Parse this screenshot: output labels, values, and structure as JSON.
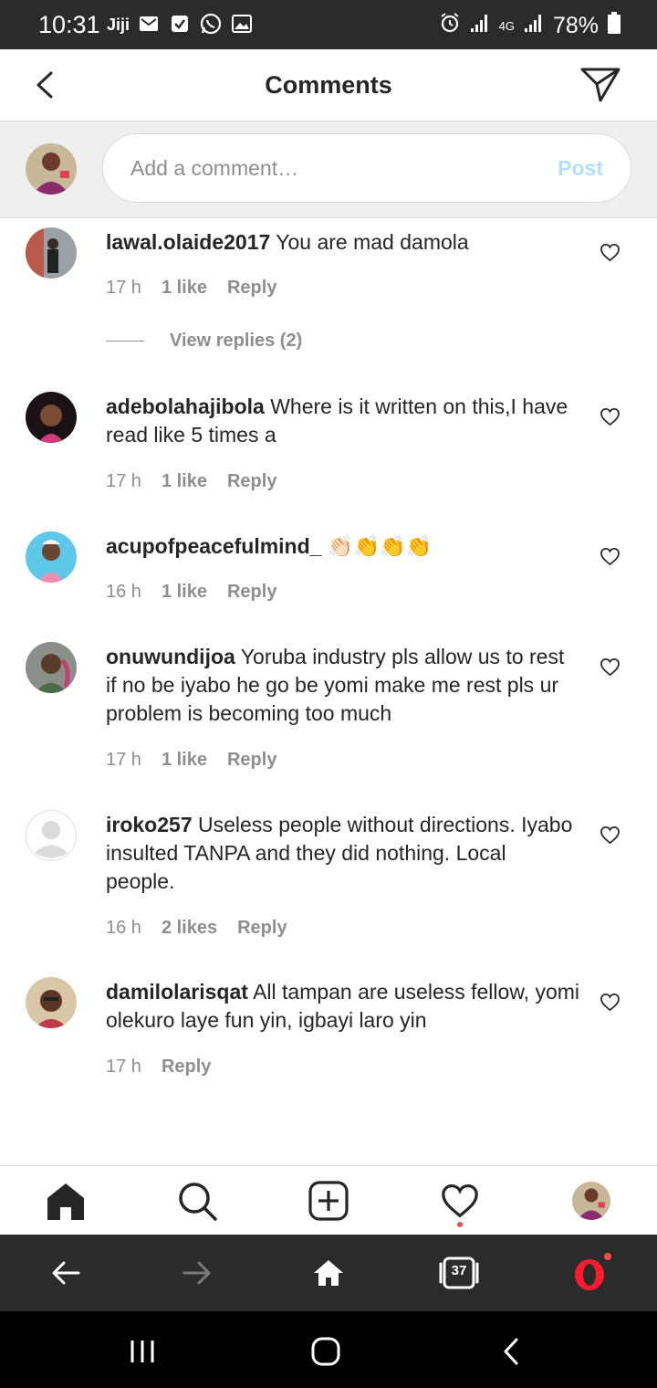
{
  "status_bar": {
    "time": "10:31",
    "battery": "78%",
    "network": "4G",
    "left_icons": [
      "jiji-icon",
      "gmail-icon",
      "checkbox-icon",
      "whatsapp-icon",
      "gallery-icon"
    ],
    "right_icons": [
      "alarm-icon",
      "signal-icon",
      "signal-icon",
      "battery-icon"
    ]
  },
  "header": {
    "title": "Comments",
    "back_icon": "chevron-left-icon",
    "share_icon": "direct-message-icon"
  },
  "add_comment": {
    "placeholder": "Add a comment…",
    "post_label": "Post"
  },
  "comments": [
    {
      "username": "lawal.olaide2017",
      "text": "You are mad damola",
      "time": "17 h",
      "likes": "1 like",
      "reply": "Reply",
      "view_replies": "View replies (2)"
    },
    {
      "username": "adebolahajibola",
      "text": "Where is it written on this,I have read like 5 times a",
      "time": "17 h",
      "likes": "1 like",
      "reply": "Reply"
    },
    {
      "username": "acupofpeacefulmind_",
      "text": "👏🏻👏👏👏",
      "time": "16 h",
      "likes": "1 like",
      "reply": "Reply"
    },
    {
      "username": "onuwundijoa",
      "text": "Yoruba industry pls allow us to rest if no be iyabo he go be yomi make me rest pls ur problem is becoming too much",
      "time": "17 h",
      "likes": "1 like",
      "reply": "Reply"
    },
    {
      "username": "iroko257",
      "text": "Useless people without directions. Iyabo insulted TANPA and they did nothing. Local people.",
      "time": "16 h",
      "likes": "2 likes",
      "reply": "Reply"
    },
    {
      "username": "damilolarisqat",
      "text": "All tampan are useless fellow, yomi olekuro laye fun yin, igbayi laro yin",
      "time": "17 h",
      "reply": "Reply"
    }
  ],
  "bottom_nav": [
    "home-icon",
    "search-icon",
    "new-post-icon",
    "activity-heart-icon",
    "profile-avatar"
  ],
  "browser_bar": {
    "tabs_count": "37",
    "items": [
      "back-arrow-icon",
      "forward-arrow-icon",
      "home-icon",
      "tabs-icon",
      "opera-menu-icon"
    ]
  },
  "system_nav": [
    "recents-icon",
    "home-circle-icon",
    "back-icon"
  ],
  "colors": {
    "status_bar": "#2b2b2b",
    "post_disabled": "#b2dffc",
    "secondary_text": "#8e8e8e",
    "opera_red": "#ff1b2d",
    "notification_dot": "#ed4956"
  }
}
